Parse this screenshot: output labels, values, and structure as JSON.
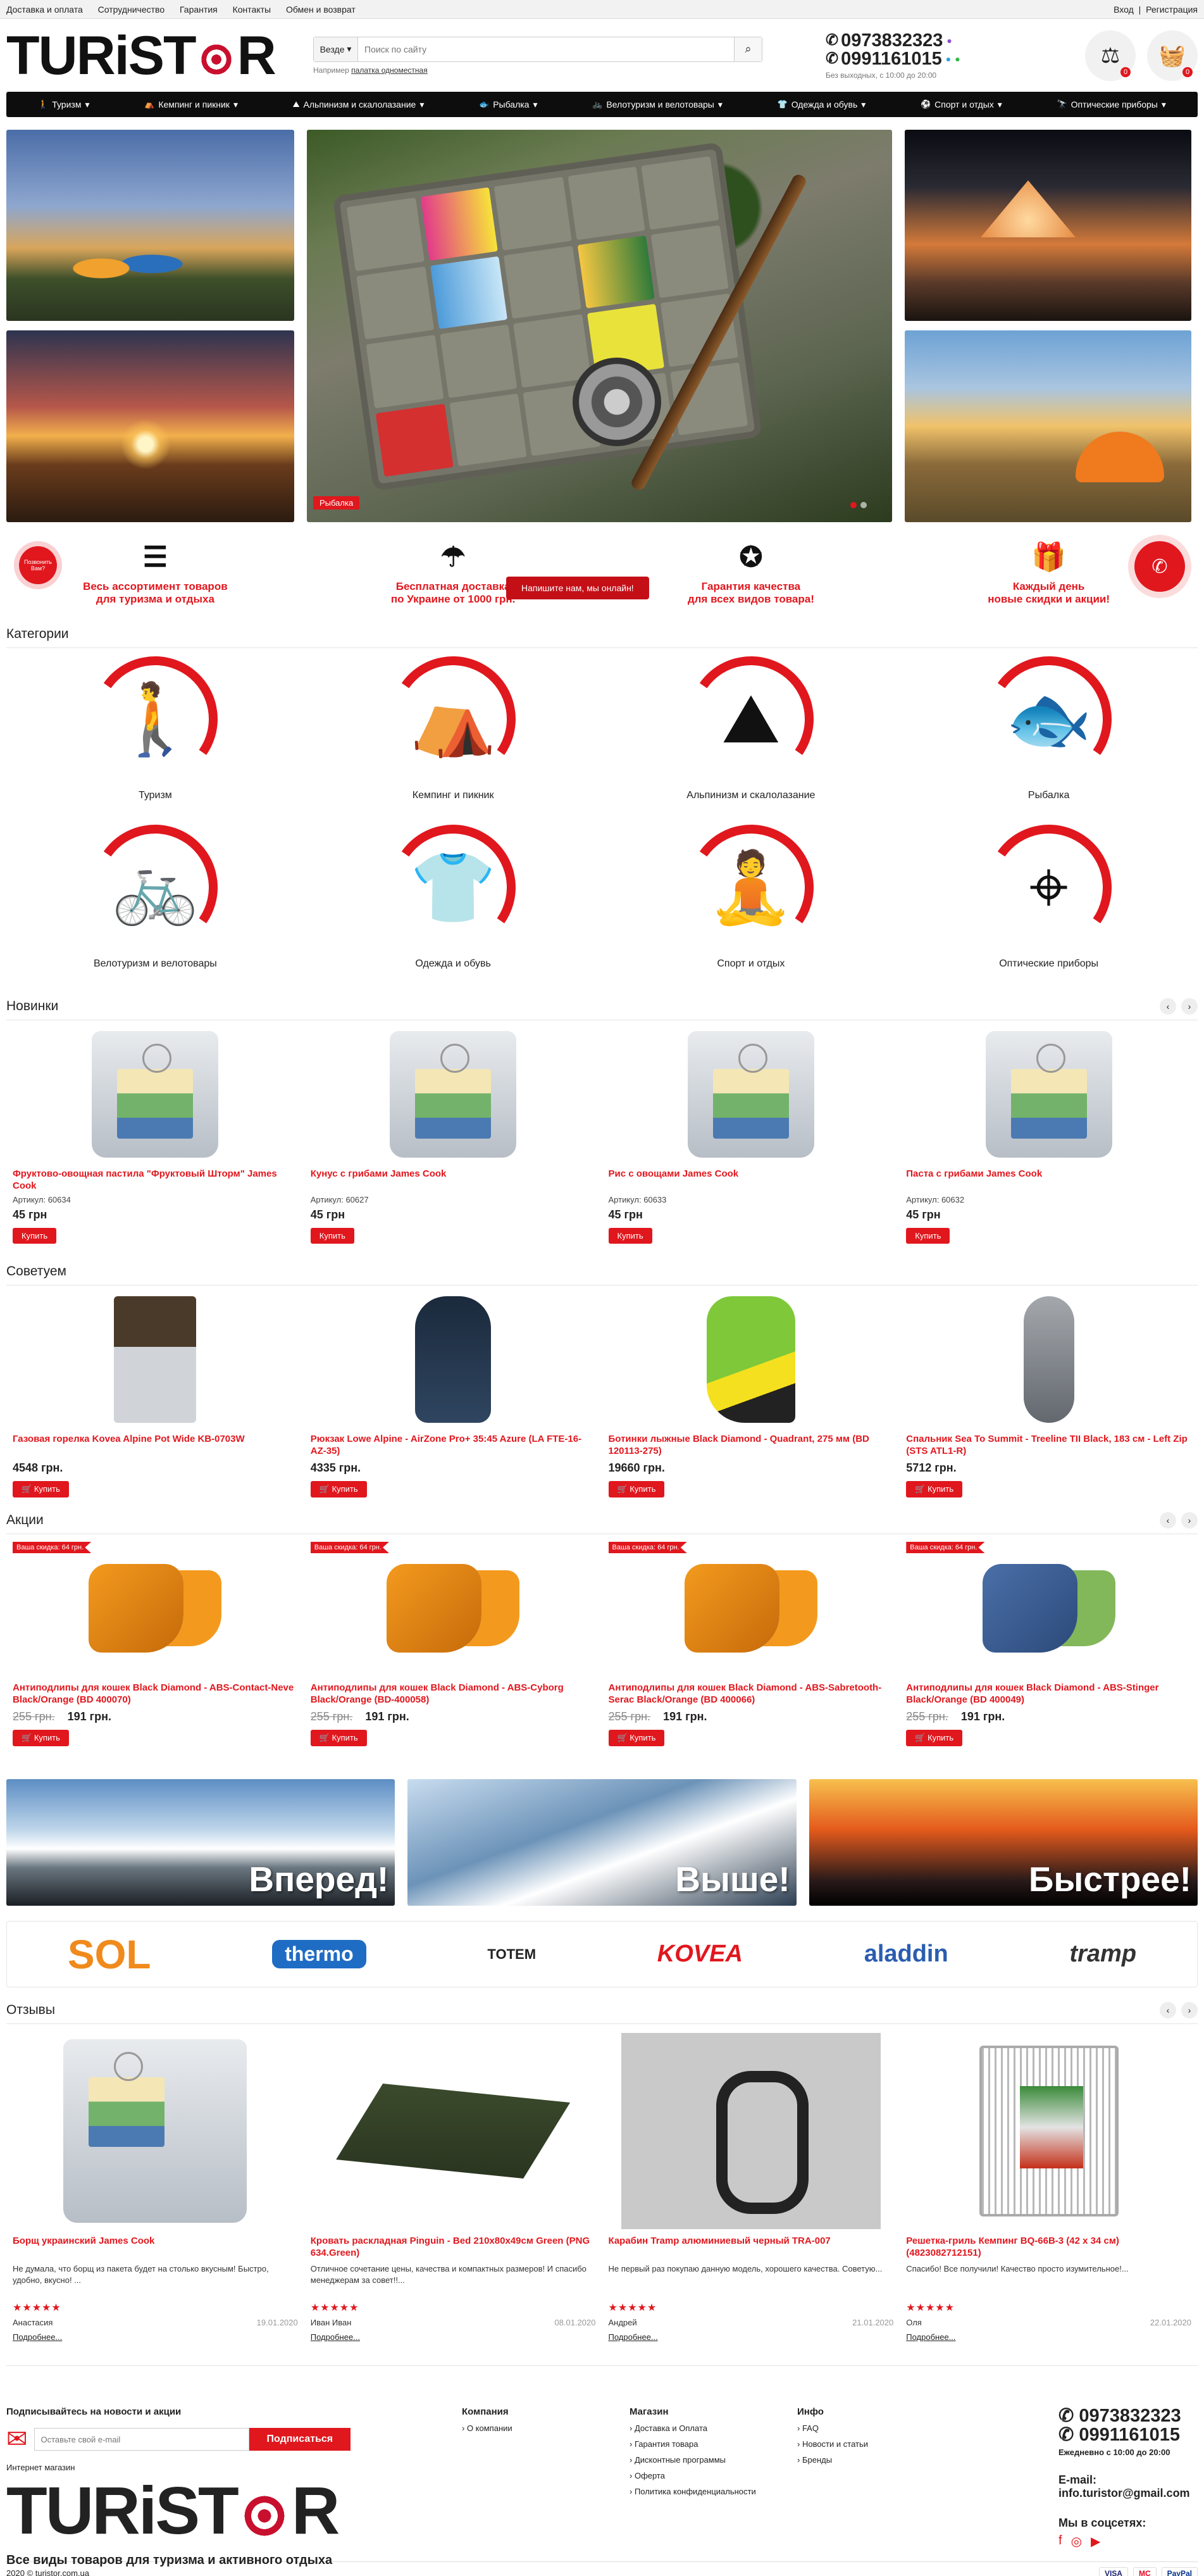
{
  "topbar": {
    "links": [
      "Доставка и оплата",
      "Сотрудничество",
      "Гарантия",
      "Контакты",
      "Обмен и возврат"
    ],
    "login": "Вход",
    "separator": "|",
    "register": "Регистрация"
  },
  "header": {
    "logo": {
      "left": "TUR",
      "i": "i",
      "st": "ST",
      "r": "R"
    },
    "search": {
      "category": "Везде",
      "placeholder": "Поиск по сайту",
      "hint_prefix": "Например",
      "hint_example": "палатка одноместная"
    },
    "phones": [
      "0973832323",
      "0991161015"
    ],
    "hours": "Без выходных, с 10:00 до 20:00",
    "compare_count": "0",
    "cart_count": "0"
  },
  "nav": [
    "Туризм",
    "Кемпинг и пикник",
    "Альпинизм и скалолазание",
    "Рыбалка",
    "Велотуризм и велотовары",
    "Одежда и обувь",
    "Спорт и отдых",
    "Оптические приборы"
  ],
  "hero": {
    "label": "Рыбалка"
  },
  "features": [
    {
      "icon": "checklist-icon",
      "line1": "Весь ассортимент товаров",
      "line2": "для туризма и отдыха"
    },
    {
      "icon": "parachute-icon",
      "line1": "Бесплатная доставка",
      "line2": "по Украине от 1000 грн."
    },
    {
      "icon": "award-icon",
      "line1": "Гарантия качества",
      "line2": "для всех видов товара!"
    },
    {
      "icon": "gift-icon",
      "line1": "Каждый день",
      "line2": "новые скидки и акции!"
    }
  ],
  "callback": {
    "left": "Позвонить Вам?",
    "chat": "Напишите нам, мы онлайн!"
  },
  "sections": {
    "categories": "Категории",
    "new": "Новинки",
    "advice": "Советуем",
    "sales": "Акции",
    "reviews": "Отзывы"
  },
  "categories": [
    "Туризм",
    "Кемпинг и пикник",
    "Альпинизм и скалолазание",
    "Рыбалка",
    "Велотуризм и велотовары",
    "Одежда и обувь",
    "Спорт и отдых",
    "Оптические приборы"
  ],
  "buy_label": "Купить",
  "new_products": [
    {
      "name": "Фруктово-овощная пастила \"Фруктовый Шторм\" James Cook",
      "sku": "Артикул: 60634",
      "price": "45 грн"
    },
    {
      "name": "Кунус с грибами James Cook",
      "sku": "Артикул: 60627",
      "price": "45 грн"
    },
    {
      "name": "Рис с овощами James Cook",
      "sku": "Артикул: 60633",
      "price": "45 грн"
    },
    {
      "name": "Паста с грибами James Cook",
      "sku": "Артикул: 60632",
      "price": "45 грн"
    }
  ],
  "advice_products": [
    {
      "name": "Газовая горелка Kovea Alpine Pot Wide KB-0703W",
      "price": "4548 грн."
    },
    {
      "name": "Рюкзак Lowe Alpine - AirZone Pro+ 35:45 Azure (LA FTE-16-AZ-35)",
      "price": "4335 грн."
    },
    {
      "name": "Ботинки лыжные Black Diamond - Quadrant, 275 мм (BD 120113-275)",
      "price": "19660 грн."
    },
    {
      "name": "Спальник Sea To Summit - Treeline TII Black, 183 см - Left Zip (STS ATL1-R)",
      "price": "5712 грн."
    }
  ],
  "sale_tag": "Ваша скидка: 64 грн.",
  "sale_products": [
    {
      "name": "Антиподлипы для кошек Black Diamond - ABS-Contact-Neve Black/Orange (BD 400070)",
      "old": "255 грн.",
      "price": "191 грн."
    },
    {
      "name": "Антиподлипы для кошек Black Diamond - ABS-Cyborg Black/Orange (BD-400058)",
      "old": "255 грн.",
      "price": "191 грн."
    },
    {
      "name": "Антиподлипы для кошек Black Diamond - ABS-Sabretooth-Serac Black/Orange (BD 400066)",
      "old": "255 грн.",
      "price": "191 грн."
    },
    {
      "name": "Антиподлипы для кошек Black Diamond - ABS-Stinger Black/Orange (BD 400049)",
      "old": "255 грн.",
      "price": "191 грн."
    }
  ],
  "banners": [
    "Вперед!",
    "Выше!",
    "Быстрее!"
  ],
  "brands": [
    "SOL",
    "thermo",
    "TOTEM",
    "KOVEA",
    "aladdin",
    "tramp"
  ],
  "reviews": [
    {
      "product": "Борщ украинский James Cook",
      "text": "Не думала, что борщ из пакета будет на столько вкусным! Быстро, удобно, вкусно! ...",
      "stars": "★★★★★",
      "author": "Анастасия",
      "date": "19.01.2020"
    },
    {
      "product": "Кровать раскладная Pinguin - Bed 210x80x49см Green (PNG 634.Green)",
      "text": "Отличное сочетание цены, качества и компактных размеров! И спасибо менеджерам за совет!!...",
      "stars": "★★★★★",
      "author": "Иван Иван",
      "date": "08.01.2020"
    },
    {
      "product": "Карабин Tramp алюминиевый черный TRA-007",
      "text": "Не первый раз покупаю данную модель, хорошего качества. Советую...",
      "stars": "★★★★★",
      "author": "Андрей",
      "date": "21.01.2020"
    },
    {
      "product": "Решетка-гриль Кемпинг BQ-66B-3 (42 х 34 см) (4823082712151)",
      "text": "Спасибо! Все получили! Качество просто изумительное!...",
      "stars": "★★★★★",
      "author": "Оля",
      "date": "22.01.2020"
    }
  ],
  "more_label": "Подробнее...",
  "footer": {
    "subscribe_title": "Подписывайтесь на новости и акции",
    "email_placeholder": "Оставьте свой e-mail",
    "subscribe_btn": "Подписаться",
    "shop_label": "Интернет магазин",
    "tagline": "Все виды товаров для туризма и активного отдыха",
    "company_title": "Компания",
    "company_links": [
      "О компании"
    ],
    "shop_title": "Магазин",
    "shop_links": [
      "Доставка и Оплата",
      "Гарантия товара",
      "Дисконтные программы",
      "Оферта",
      "Политика конфиденциальности"
    ],
    "info_title": "Инфо",
    "info_links": [
      "FAQ",
      "Новости и статьи",
      "Бренды"
    ],
    "phones": [
      "0973832323",
      "0991161015"
    ],
    "hours": "Ежедневно с 10:00 до 20:00",
    "email_label": "E-mail:",
    "email": "info.turistor@gmail.com",
    "social_label": "Мы в соцсетях:",
    "copyright": "2020 © turistor.com.ua",
    "payments": [
      "VISA",
      "MC",
      "PayPal"
    ]
  }
}
